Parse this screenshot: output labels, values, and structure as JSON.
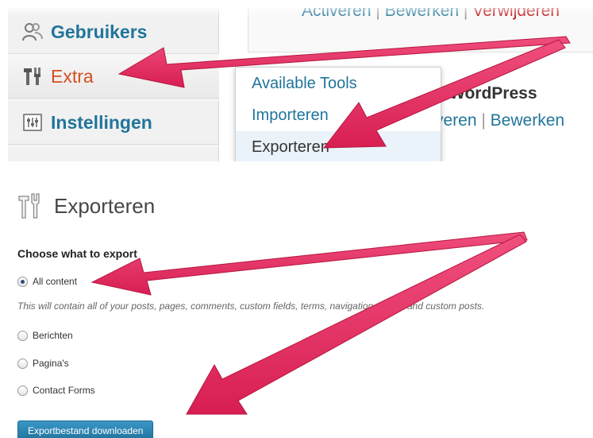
{
  "menu": {
    "items": [
      {
        "label": "Gebruikers",
        "icon": "users-icon"
      },
      {
        "label": "Extra",
        "icon": "tools-icon",
        "active": true
      },
      {
        "label": "Instellingen",
        "icon": "settings-icon"
      }
    ],
    "submenu": [
      {
        "label": "Available Tools"
      },
      {
        "label": "Importeren"
      },
      {
        "label": "Exporteren",
        "current": true
      }
    ]
  },
  "plugins": {
    "row1_links": {
      "activate": "Activeren",
      "edit": "Bewerken",
      "delete": "Verwijderen",
      "separator": "|"
    },
    "row2_title": "r WordPress",
    "row2_links": {
      "activate": "veren",
      "edit": "Bewerken",
      "separator": "|"
    }
  },
  "export": {
    "title": "Exporteren",
    "section_heading": "Choose what to export",
    "options": [
      {
        "label": "All content",
        "checked": true
      },
      {
        "label": "Berichten",
        "checked": false
      },
      {
        "label": "Pagina's",
        "checked": false
      },
      {
        "label": "Contact Forms",
        "checked": false
      }
    ],
    "description": "This will contain all of your posts, pages, comments, custom fields, terms, navigation menus and custom posts.",
    "download_button": "Exportbestand downloaden"
  },
  "colors": {
    "link": "#21759b",
    "active_menu": "#d54e21",
    "arrow": "#e8245c",
    "button": "#21759b"
  }
}
